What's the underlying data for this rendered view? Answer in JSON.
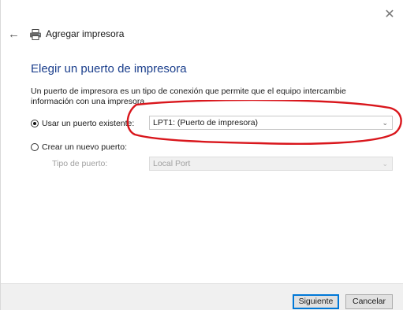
{
  "window": {
    "title": "Agregar impresora",
    "close_glyph": "✕",
    "back_glyph": "←",
    "title_icon": "printer-icon"
  },
  "page": {
    "heading": "Elegir un puerto de impresora",
    "description": "Un puerto de impresora es un tipo de conexión que permite que el equipo intercambie información con una impresora."
  },
  "options": {
    "existing_port": {
      "label": "Usar un puerto existente:",
      "selected": true,
      "value": "LPT1: (Puerto de impresora)"
    },
    "new_port": {
      "label": "Crear un nuevo puerto:",
      "selected": false,
      "type_label": "Tipo de puerto:",
      "type_value": "Local Port"
    }
  },
  "buttons": {
    "next": "Siguiente",
    "cancel": "Cancelar"
  },
  "colors": {
    "heading": "#1a3e8c",
    "annotation": "#d9161c",
    "primary_border": "#0078d7"
  }
}
